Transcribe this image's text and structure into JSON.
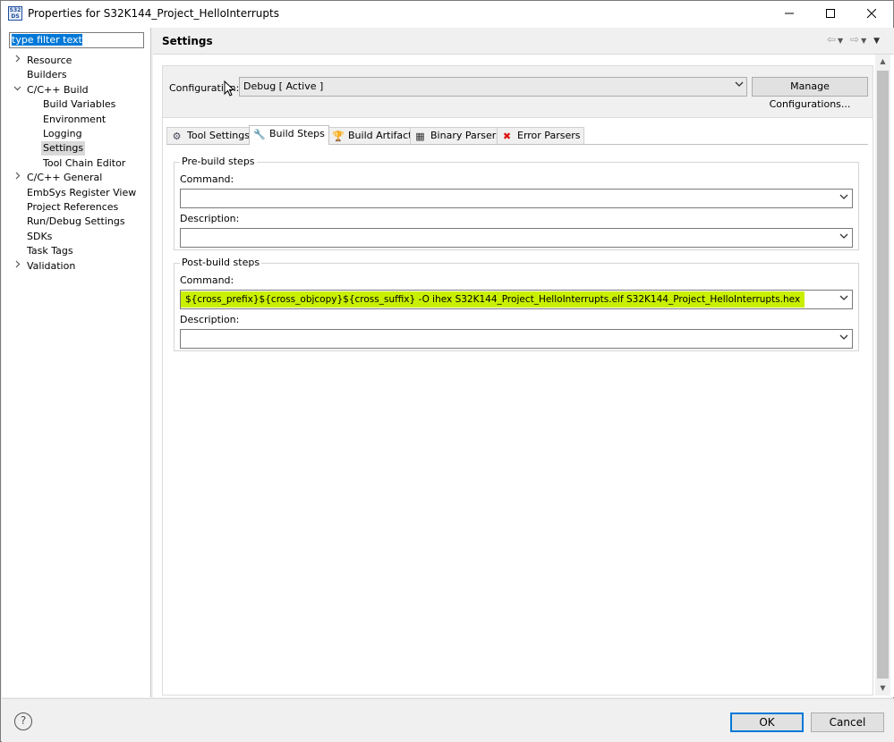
{
  "window": {
    "title": "Properties for S32K144_Project_HelloInterrupts",
    "icon": "s32-ds-app-icon",
    "icon_text": "S32 DS"
  },
  "filter": {
    "value": "type filter text"
  },
  "tree": [
    {
      "label": "Resource",
      "chevron": "right"
    },
    {
      "label": "Builders",
      "chevron": ""
    },
    {
      "label": "C/C++ Build",
      "chevron": "down"
    },
    {
      "label": "Build Variables",
      "chevron": ""
    },
    {
      "label": "Environment",
      "chevron": ""
    },
    {
      "label": "Logging",
      "chevron": ""
    },
    {
      "label": "Settings",
      "chevron": "",
      "selected": true
    },
    {
      "label": "Tool Chain Editor",
      "chevron": ""
    },
    {
      "label": "C/C++ General",
      "chevron": "right"
    },
    {
      "label": "EmbSys Register View",
      "chevron": ""
    },
    {
      "label": "Project References",
      "chevron": ""
    },
    {
      "label": "Run/Debug Settings",
      "chevron": ""
    },
    {
      "label": "SDKs",
      "chevron": ""
    },
    {
      "label": "Task Tags",
      "chevron": ""
    },
    {
      "label": "Validation",
      "chevron": "right"
    }
  ],
  "settings": {
    "title": "Settings",
    "configuration_label": "Configuration:",
    "configuration_value": "Debug  [ Active ]",
    "manage_label": "Manage Configurations...",
    "tabs": [
      {
        "label": "Tool Settings",
        "icon": "tool-settings-icon"
      },
      {
        "label": "Build Steps",
        "icon": "build-steps-icon",
        "active": true
      },
      {
        "label": "Build Artifact",
        "icon": "trophy-icon"
      },
      {
        "label": "Binary Parsers",
        "icon": "binary-icon"
      },
      {
        "label": "Error Parsers",
        "icon": "error-icon"
      }
    ],
    "pre_build": {
      "title": "Pre-build steps",
      "command_label": "Command:",
      "command_value": "",
      "description_label": "Description:",
      "description_value": ""
    },
    "post_build": {
      "title": "Post-build steps",
      "command_label": "Command:",
      "command_value": "${cross_prefix}${cross_objcopy}${cross_suffix} -O ihex S32K144_Project_HelloInterrupts.elf S32K144_Project_HelloInterrupts.hex",
      "description_label": "Description:",
      "description_value": ""
    }
  },
  "buttons": {
    "ok": "OK",
    "cancel": "Cancel"
  },
  "colors": {
    "highlight": "#c8f000",
    "selection": "#0078d7"
  }
}
